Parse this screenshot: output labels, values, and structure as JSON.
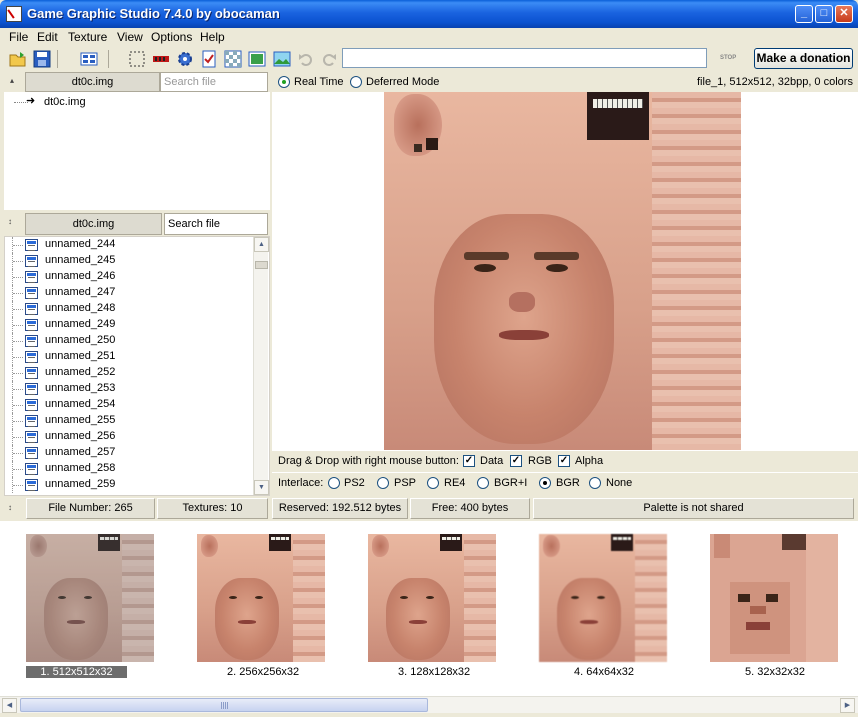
{
  "window": {
    "title": "Game Graphic Studio 7.4.0 by obocaman",
    "min_label": "_",
    "max_label": "□",
    "close_label": "✕"
  },
  "menu": [
    "File",
    "Edit",
    "Texture",
    "View",
    "Options",
    "Help"
  ],
  "toolbar": {
    "stop_label": "STOP",
    "donate_label": "Make a donation",
    "input_value": ""
  },
  "top_pane": {
    "tab_label": "dt0c.img",
    "search_placeholder": "Search file",
    "tree_item": "dt0c.img"
  },
  "list_pane": {
    "tab_label": "dt0c.img",
    "search_value": "Search file",
    "files": [
      "unnamed_244",
      "unnamed_245",
      "unnamed_246",
      "unnamed_247",
      "unnamed_248",
      "unnamed_249",
      "unnamed_250",
      "unnamed_251",
      "unnamed_252",
      "unnamed_253",
      "unnamed_254",
      "unnamed_255",
      "unnamed_256",
      "unnamed_257",
      "unnamed_258",
      "unnamed_259"
    ]
  },
  "mode": {
    "real_time": "Real Time",
    "deferred": "Deferred Mode",
    "selected": "Real Time",
    "file_info": "file_1, 512x512, 32bpp, 0 colors"
  },
  "drag_drop": {
    "label": "Drag & Drop with right mouse button:",
    "data": "Data",
    "rgb": "RGB",
    "alpha": "Alpha"
  },
  "interlace": {
    "label": "Interlace:",
    "options": [
      "PS2",
      "PSP",
      "RE4",
      "BGR+I",
      "BGR",
      "None"
    ],
    "selected": "BGR"
  },
  "status": {
    "file_number": "File Number: 265",
    "textures": "Textures: 10",
    "reserved": "Reserved: 192.512 bytes",
    "free": "Free: 400 bytes",
    "palette": "Palette is not shared"
  },
  "thumbnails": [
    {
      "label": "1. 512x512x32",
      "selected": true
    },
    {
      "label": "2. 256x256x32",
      "selected": false
    },
    {
      "label": "3. 128x128x32",
      "selected": false
    },
    {
      "label": "4. 64x64x32",
      "selected": false
    },
    {
      "label": "5. 32x32x32",
      "selected": false
    }
  ],
  "colors": {
    "titlebar": "#1a63e0",
    "skin": "#d8a08a",
    "selection": "#6d6d6d"
  }
}
